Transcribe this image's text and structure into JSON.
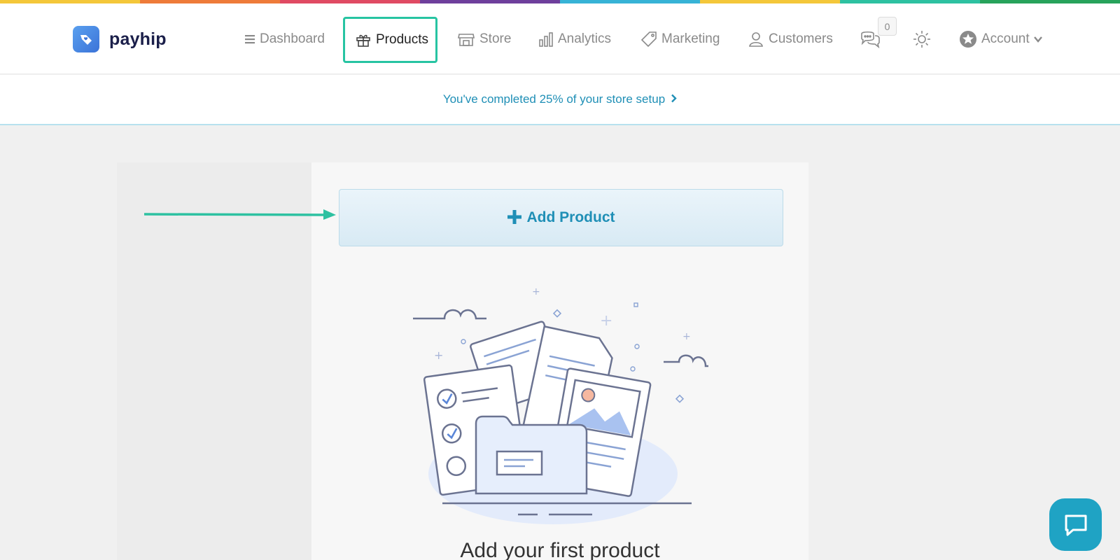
{
  "rainbow_colors": [
    "#f4c73a",
    "#ee7b3a",
    "#e04a63",
    "#6e3f9c",
    "#37b3d6",
    "#f4c73a",
    "#2ec1a1",
    "#27a35b"
  ],
  "brand": {
    "name": "payhip",
    "logo_icon": "heart-tag-icon"
  },
  "nav": {
    "dashboard": {
      "label": "Dashboard",
      "icon": "menu-icon"
    },
    "products": {
      "label": "Products",
      "icon": "gift-icon"
    },
    "store": {
      "label": "Store",
      "icon": "store-icon"
    },
    "analytics": {
      "label": "Analytics",
      "icon": "bar-chart-icon"
    },
    "marketing": {
      "label": "Marketing",
      "icon": "tag-icon"
    },
    "customers": {
      "label": "Customers",
      "icon": "user-icon"
    },
    "messages": {
      "icon": "chat-bubbles-icon",
      "count": "0"
    },
    "theme": {
      "icon": "sun-icon"
    },
    "account": {
      "label": "Account",
      "icon": "star-badge-icon",
      "chevron": "❯"
    }
  },
  "setup_banner": {
    "text": "You've completed 25% of your store setup",
    "progress_percent": 25
  },
  "main": {
    "add_product_label": "Add Product",
    "add_product_icon": "plus-icon",
    "empty_title": "Add your first product"
  },
  "colors": {
    "accent": "#1f8fb6",
    "highlight": "#27c4a2",
    "chat": "#1fa3c4"
  },
  "chat_widget": {
    "icon": "speech-bubble-icon"
  }
}
